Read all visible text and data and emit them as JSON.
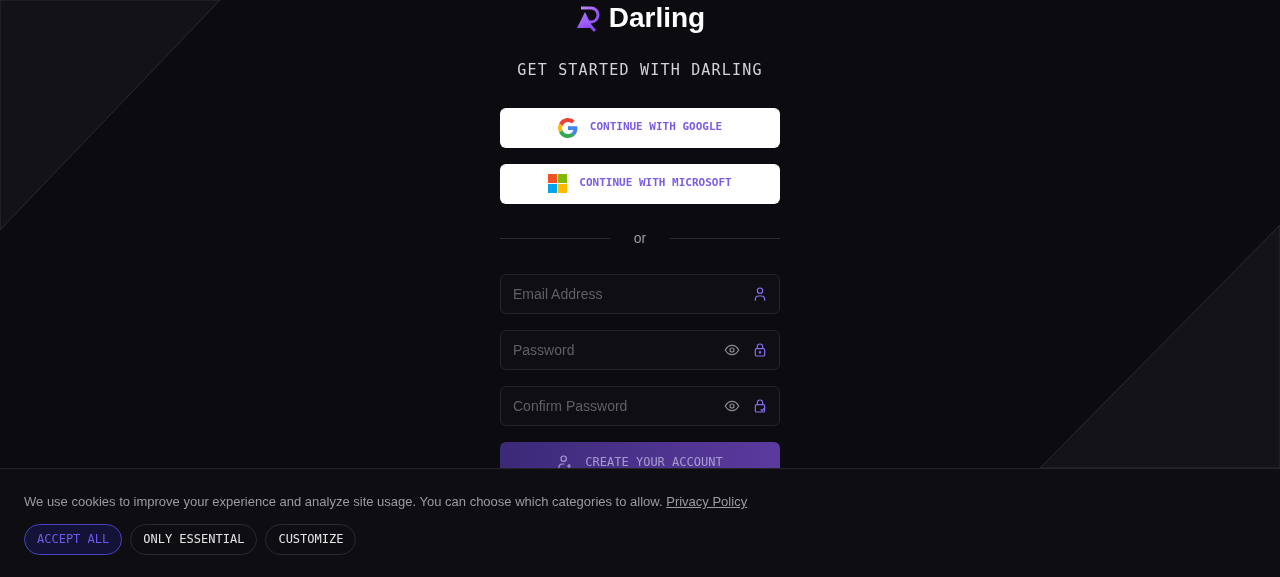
{
  "logo": {
    "text": "Darling"
  },
  "heading": "GET STARTED WITH DARLING",
  "social_buttons": [
    {
      "kind": "google",
      "label": "CONTINUE WITH GOOGLE"
    },
    {
      "kind": "microsoft",
      "label": "CONTINUE WITH MICROSOFT"
    }
  ],
  "divider": "or",
  "fields": [
    {
      "kind": "email",
      "placeholder": "Email Address"
    },
    {
      "kind": "password",
      "placeholder": "Password"
    },
    {
      "kind": "confirm",
      "placeholder": "Confirm Password"
    }
  ],
  "submit": {
    "label": "CREATE YOUR ACCOUNT"
  },
  "cookie_banner": {
    "text": "We use cookies to improve your experience and analyze site usage. You can choose which categories to allow.",
    "link": "Privacy Policy",
    "buttons": [
      {
        "label": "ACCEPT ALL",
        "selected": true
      },
      {
        "label": "ONLY ESSENTIAL",
        "selected": false
      },
      {
        "label": "CUSTOMIZE",
        "selected": false
      }
    ]
  }
}
